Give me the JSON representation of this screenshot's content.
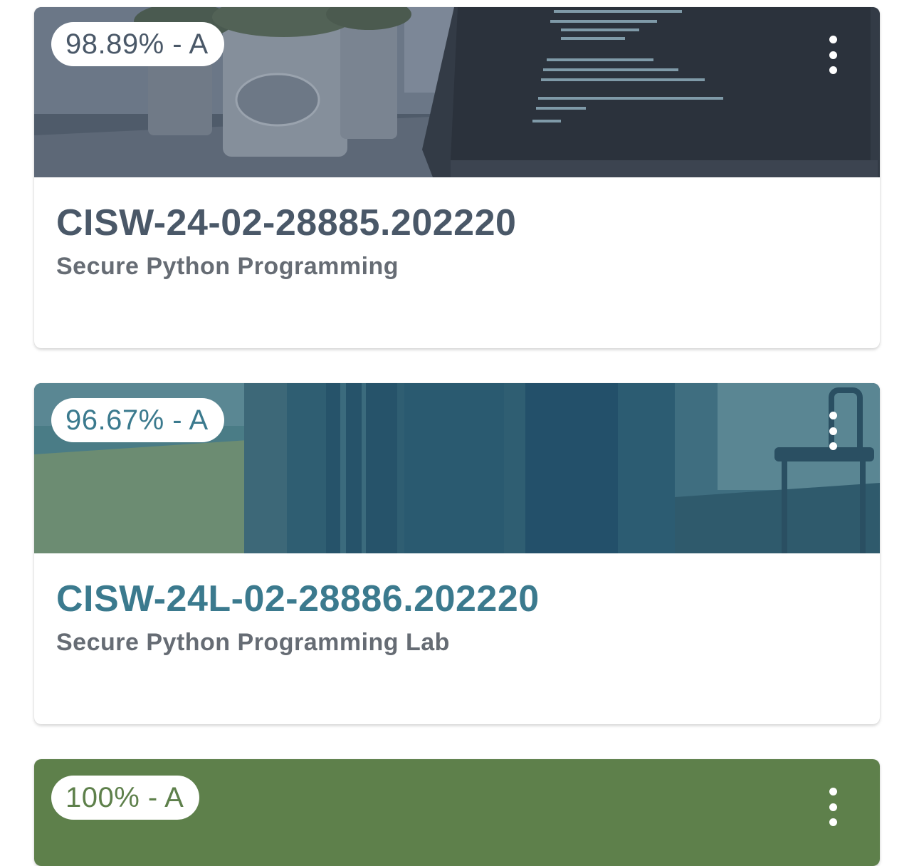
{
  "courses": [
    {
      "grade": "98.89% - A",
      "code": "CISW-24-02-28885.202220",
      "name": "Secure Python Programming",
      "color": "#4a5868"
    },
    {
      "grade": "96.67% - A",
      "code": "CISW-24L-02-28886.202220",
      "name": "Secure Python Programming Lab",
      "color": "#3b7a8e"
    },
    {
      "grade": "100% - A",
      "code": "",
      "name": "",
      "color": "#5e804b"
    }
  ],
  "menu_icon": "more-vertical-icon"
}
